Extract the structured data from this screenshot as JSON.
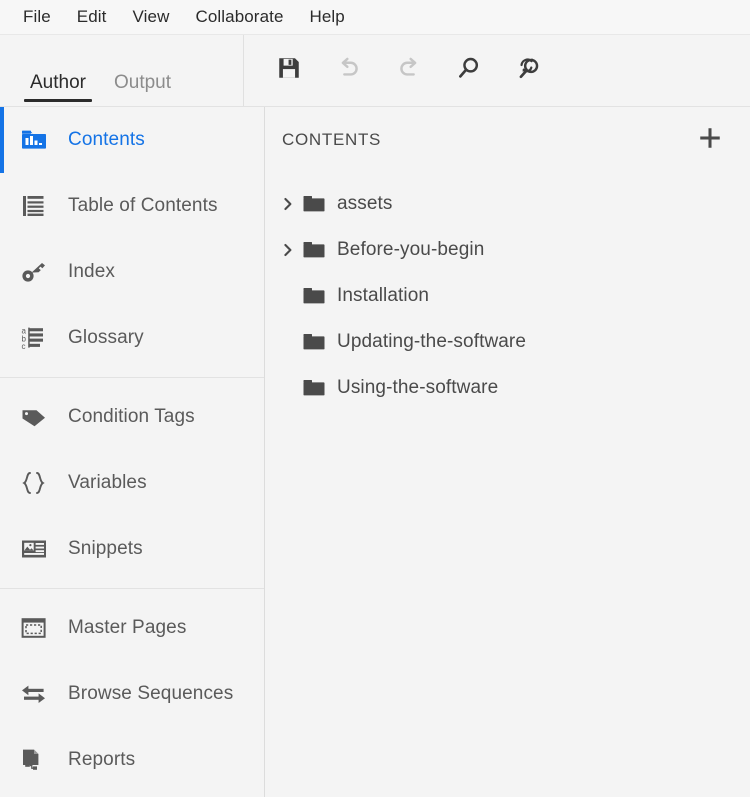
{
  "menubar": {
    "items": [
      {
        "label": "File"
      },
      {
        "label": "Edit"
      },
      {
        "label": "View"
      },
      {
        "label": "Collaborate"
      },
      {
        "label": "Help"
      }
    ]
  },
  "tabs": [
    {
      "label": "Author",
      "active": true
    },
    {
      "label": "Output",
      "active": false
    }
  ],
  "toolbar": {
    "buttons": [
      {
        "icon": "save-icon",
        "label": "Save",
        "enabled": true
      },
      {
        "icon": "undo-icon",
        "label": "Undo",
        "enabled": false
      },
      {
        "icon": "redo-icon",
        "label": "Redo",
        "enabled": false
      },
      {
        "icon": "search-icon",
        "label": "Find",
        "enabled": true
      },
      {
        "icon": "find-replace-icon",
        "label": "Find and Replace",
        "enabled": true
      }
    ]
  },
  "sidebar": {
    "groups": [
      {
        "items": [
          {
            "label": "Contents",
            "icon": "contents-folder-chart-icon",
            "active": true
          },
          {
            "label": "Table of Contents",
            "icon": "table-of-contents-icon",
            "active": false
          },
          {
            "label": "Index",
            "icon": "key-icon",
            "active": false
          },
          {
            "label": "Glossary",
            "icon": "abc-list-icon",
            "active": false
          }
        ]
      },
      {
        "items": [
          {
            "label": "Condition Tags",
            "icon": "tag-icon",
            "active": false
          },
          {
            "label": "Variables",
            "icon": "braces-icon",
            "active": false
          },
          {
            "label": "Snippets",
            "icon": "snippet-card-icon",
            "active": false
          }
        ]
      },
      {
        "items": [
          {
            "label": "Master Pages",
            "icon": "master-page-icon",
            "active": false
          },
          {
            "label": "Browse Sequences",
            "icon": "arrows-lr-icon",
            "active": false
          },
          {
            "label": "Reports",
            "icon": "report-doc-icon",
            "active": false
          }
        ]
      }
    ]
  },
  "content": {
    "title": "CONTENTS",
    "add_icon": "plus-icon",
    "tree": [
      {
        "label": "assets",
        "expandable": true,
        "expanded": false
      },
      {
        "label": "Before-you-begin",
        "expandable": true,
        "expanded": false
      },
      {
        "label": "Installation",
        "expandable": false,
        "expanded": false
      },
      {
        "label": "Updating-the-software",
        "expandable": false,
        "expanded": false
      },
      {
        "label": "Using-the-software",
        "expandable": false,
        "expanded": false
      }
    ]
  },
  "colors": {
    "accent": "#1473E6",
    "text": "#4A4A4A",
    "menu_text": "#2B2B2B",
    "icon": "#4A4A4A",
    "icon_disabled": "#C6C6C6",
    "bg": "#F4F4F4",
    "menubar_bg": "#F7F7F7",
    "divider": "#E2E2E2"
  }
}
